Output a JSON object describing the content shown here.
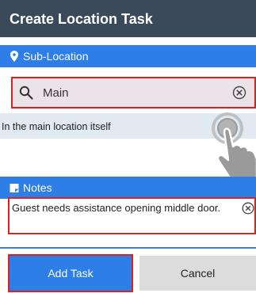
{
  "title": "Create Location Task",
  "sub_location": {
    "label": "Sub-Location",
    "search_value": "Main",
    "result": "In the main location itself"
  },
  "notes": {
    "label": "Notes",
    "text": "Guest needs assistance opening middle door."
  },
  "buttons": {
    "add": "Add Task",
    "cancel": "Cancel"
  },
  "colors": {
    "titlebar": "#3b4a58",
    "accent": "#2d7ee6",
    "highlight": "#e02020"
  },
  "icons": {
    "sub_location": "map-pin-icon",
    "search": "search-icon",
    "clear": "clear-circle-icon",
    "notes": "note-icon",
    "gesture": "tap-hand-icon"
  }
}
